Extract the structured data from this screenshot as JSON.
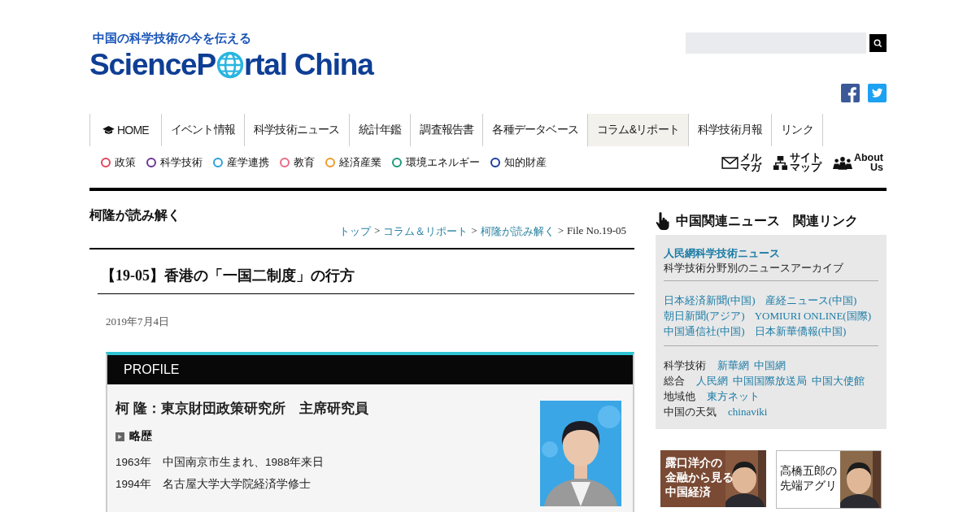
{
  "header": {
    "tagline": "中国の科学技術の今を伝える",
    "logo_before": "ScienceP",
    "logo_after": "rtal China"
  },
  "nav": [
    {
      "label": "HOME",
      "kind": "home",
      "selected": false
    },
    {
      "label": "イベント情報",
      "kind": "text",
      "selected": false
    },
    {
      "label": "科学技術ニュース",
      "kind": "text",
      "selected": false
    },
    {
      "label": "統計年鑑",
      "kind": "text",
      "selected": false
    },
    {
      "label": "調査報告書",
      "kind": "text",
      "selected": false
    },
    {
      "label": "各種データベース",
      "kind": "text",
      "selected": false
    },
    {
      "label": "コラム&リポート",
      "kind": "text",
      "selected": true
    },
    {
      "label": "科学技術月報",
      "kind": "text",
      "selected": false
    },
    {
      "label": "リンク",
      "kind": "text",
      "selected": false
    }
  ],
  "categories": [
    {
      "label": "政策",
      "color": "#e0445a"
    },
    {
      "label": "科学技術",
      "color": "#6b3593"
    },
    {
      "label": "産学連携",
      "color": "#2a9fdc"
    },
    {
      "label": "教育",
      "color": "#ea6a82"
    },
    {
      "label": "経済産業",
      "color": "#f09a2a"
    },
    {
      "label": "環境エネルギー",
      "color": "#1a9a7a"
    },
    {
      "label": "知的財産",
      "color": "#1c3c9c"
    }
  ],
  "utility_links": [
    {
      "kind": "mail",
      "lines": [
        "メル",
        "マガ"
      ]
    },
    {
      "kind": "sitemap",
      "lines": [
        "サイト",
        "マップ"
      ]
    },
    {
      "kind": "about",
      "lines": [
        "About",
        "Us"
      ]
    }
  ],
  "section_title": "柯隆が読み解く",
  "breadcrumb_separator": ">",
  "breadcrumb": [
    {
      "label": "トップ",
      "link": true
    },
    {
      "label": "コラム＆リポート",
      "link": true
    },
    {
      "label": "柯隆が読み解く",
      "link": true
    },
    {
      "label": "File No.19-05",
      "link": false
    }
  ],
  "article": {
    "title_prefix": "【19-05】",
    "title": "香港の「一国二制度」の行方",
    "date": "2019年7月4日",
    "profile": {
      "heading": "PROFILE",
      "name": "柯 隆：東京財団政策研究所　主席研究員",
      "subheading": "略歴",
      "history": [
        {
          "year": "1963年",
          "text": "中国南京市生まれ、1988年来日"
        },
        {
          "year": "1994年",
          "text": "名古屋大学大学院経済学修士"
        }
      ]
    }
  },
  "sidebar": {
    "title": "中国関連ニュース　関連リンク",
    "featured": {
      "link": "人民網科学技術ニュース",
      "description": "科学技術分野別のニュースアーカイブ"
    },
    "news_links": [
      [
        "日本経済新聞(中国)",
        "産経ニュース(中国)"
      ],
      [
        "朝日新聞(アジア)",
        "YOMIURI ONLINE(国際)"
      ],
      [
        "中国通信社(中国)",
        "日本新華僑報(中国)"
      ]
    ],
    "categories": [
      {
        "label": "科学技術",
        "links": [
          "新華網",
          "中国網"
        ]
      },
      {
        "label": "総合",
        "links": [
          "人民網",
          "中国国際放送局",
          "中国大使館"
        ]
      },
      {
        "label": "地域他",
        "links": [
          "東方ネット"
        ]
      },
      {
        "label": "中国の天気",
        "links": [
          "chinaviki"
        ]
      }
    ]
  },
  "banners": [
    {
      "kind": "brown",
      "lines": [
        "露口洋介の",
        "金融から見る",
        "中国経済"
      ]
    },
    {
      "kind": "white",
      "lines": [
        "高橋五郎の",
        "先端アグリ"
      ]
    }
  ]
}
